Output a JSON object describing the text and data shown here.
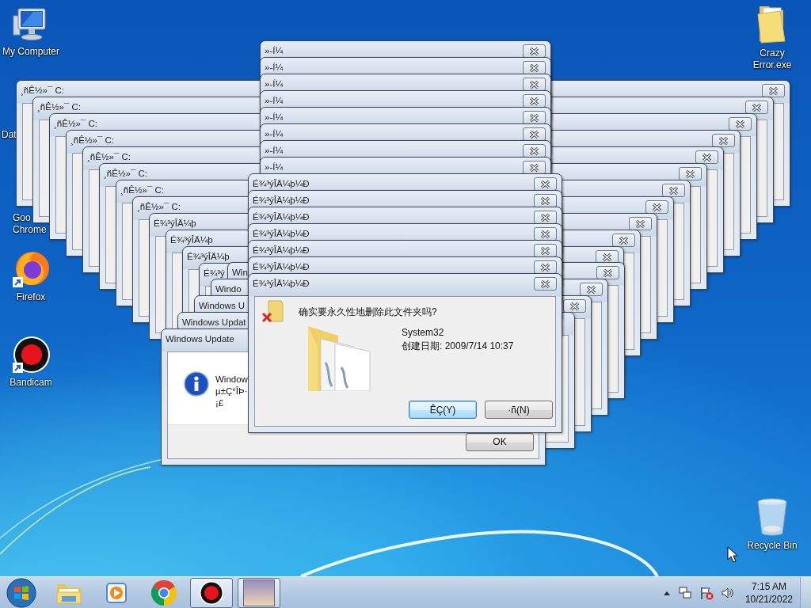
{
  "desktop_icons": [
    {
      "kind": "computer",
      "label": "My Computer"
    },
    {
      "kind": "file",
      "label": "Dat"
    },
    {
      "kind": "chrome",
      "label": "Goo Chrome"
    },
    {
      "kind": "firefox",
      "label": "Firefox"
    },
    {
      "kind": "bandicam",
      "label": "Bandicam"
    },
    {
      "kind": "folder",
      "label": "Crazy Error.exe"
    },
    {
      "kind": "recycle",
      "label": "Recycle Bin"
    }
  ],
  "back_stack": [
    {
      "title": "¸ñÊ½»¯ C:"
    },
    {
      "title": "¸ñÊ½»¯ C:"
    },
    {
      "title": "¸ñÊ½»¯ C:"
    },
    {
      "title": "¸ñÊ½»¯ C:"
    },
    {
      "title": "¸ñÊ½»¯ C:"
    },
    {
      "title": "¸ñÊ½»¯ C:"
    },
    {
      "title": "¸ñÊ½»¯ C:"
    },
    {
      "title": "¸ñÊ½»¯ C:"
    },
    {
      "title": "É¾³ýÎÄ¼þ"
    },
    {
      "title": "É¾³ýÎÄ¼þ"
    },
    {
      "title": "É¾³ýÎÄ¼þ"
    },
    {
      "title": "É¾³ý"
    }
  ],
  "paint_stack": [
    {
      "title": "»-Í¼"
    },
    {
      "title": "»-Í¼"
    },
    {
      "title": "»-Í¼"
    },
    {
      "title": "»-Í¼"
    },
    {
      "title": "»-Í¼"
    },
    {
      "title": "»-Í¼"
    },
    {
      "title": "»-Í¼"
    },
    {
      "title": "»-Í¼"
    }
  ],
  "update_stack": {
    "behind": [
      {
        "title": "Win"
      },
      {
        "title": "Windo"
      },
      {
        "title": "Windows U"
      },
      {
        "title": "Windows Updat"
      }
    ],
    "front": {
      "title": "Windows Update",
      "message": [
        "Window",
        "µ±Ç°ÎÞ·",
        "¡£"
      ],
      "button": "OK"
    }
  },
  "delete_stack": {
    "behind": [
      {
        "title": "É¾³ýÎÄ¼þ¼Ð"
      },
      {
        "title": "É¾³ýÎÄ¼þ¼Ð"
      },
      {
        "title": "É¾³ýÎÄ¼þ¼Ð"
      },
      {
        "title": "É¾³ýÎÄ¼þ¼Ð"
      },
      {
        "title": "É¾³ýÎÄ¼þ¼Ð"
      },
      {
        "title": "É¾³ýÎÄ¼þ¼Ð"
      }
    ],
    "dialog": {
      "title": "É¾³ýÎÄ¼þ¼Ð",
      "question": "确实要永久性地删除此文件夹吗?",
      "file_name": "System32",
      "created": "创建日期: 2009/7/14 10:37",
      "buttons": [
        {
          "label": "ÊÇ(Y)",
          "selected": true
        },
        {
          "label": "·ñ(N)",
          "selected": false
        }
      ]
    }
  },
  "taskbar": {
    "apps": [
      {
        "kind": "explorer",
        "active": false
      },
      {
        "kind": "media",
        "active": false
      },
      {
        "kind": "chrome",
        "active": false
      },
      {
        "kind": "bandicam",
        "active": true
      },
      {
        "kind": "picture",
        "active": true
      }
    ],
    "clock": {
      "time": "7:15 AM",
      "date": "10/21/2022"
    }
  }
}
